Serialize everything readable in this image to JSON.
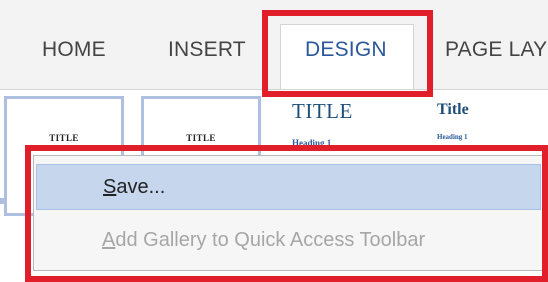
{
  "ribbon": {
    "tabs": [
      {
        "label": "HOME"
      },
      {
        "label": "INSERT"
      },
      {
        "label": "DESIGN",
        "active": true
      },
      {
        "label": "PAGE LAY"
      }
    ]
  },
  "gallery": {
    "thumb1": {
      "title": "Title"
    },
    "thumb2": {
      "title": "Title"
    },
    "style3": {
      "title": "TITLE",
      "heading": "Heading 1"
    },
    "style4": {
      "title": "Title",
      "heading": "Heading 1"
    }
  },
  "context_menu": {
    "items": [
      {
        "label": "Save...",
        "accel": "S",
        "rest": "ave...",
        "state": "hover"
      },
      {
        "label": "Add Gallery to Quick Access Toolbar",
        "accel": "A",
        "rest": "dd Gallery to Quick Access Toolbar",
        "state": "disabled"
      }
    ]
  },
  "colors": {
    "annotation_red": "#e01f2b",
    "active_tab_text": "#2b579a",
    "menu_hover": "#c5d6ed",
    "disabled_text": "#a6a6a6"
  }
}
